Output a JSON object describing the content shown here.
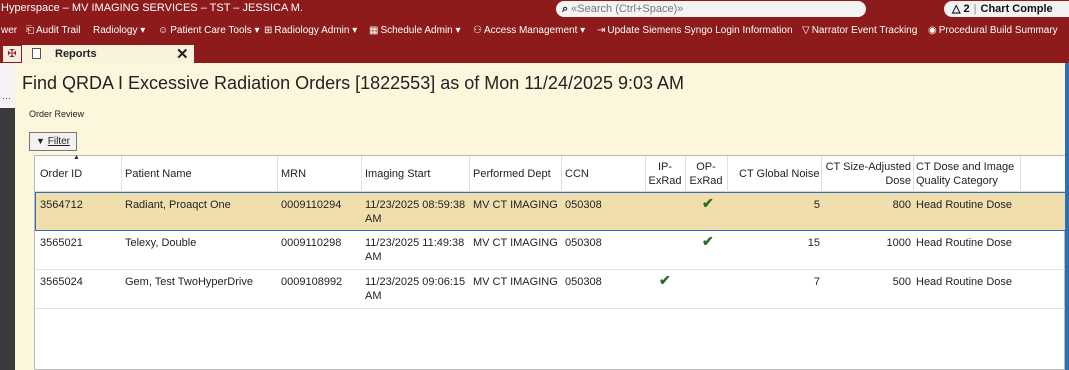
{
  "titlebar": {
    "app_title": "Hyperspace – MV IMAGING SERVICES – TST – JESSICA M.",
    "search_placeholder": "«Search (Ctrl+Space)»",
    "notify_count": "2",
    "chart_label": "Chart Comple"
  },
  "toolbar": {
    "items": [
      {
        "label": "wer"
      },
      {
        "label": "Audit Trail"
      },
      {
        "label": "Radiology ▾"
      },
      {
        "label": "Patient Care Tools ▾"
      },
      {
        "label": "Radiology Admin ▾"
      },
      {
        "label": "Schedule Admin ▾"
      },
      {
        "label": "Access Management ▾"
      },
      {
        "label": "Update Siemens Syngo Login Information"
      },
      {
        "label": "Narrator Event Tracking"
      },
      {
        "label": "Procedural Build Summary"
      }
    ]
  },
  "tabs": {
    "reports_label": "Reports"
  },
  "page": {
    "title": "Find QRDA I Excessive Radiation Orders [1822553] as of Mon 11/24/2025 9:03 AM",
    "subtitle": "Order Review",
    "filter_label": "Filter"
  },
  "table": {
    "columns": {
      "order_id": "Order ID",
      "patient_name": "Patient Name",
      "mrn": "MRN",
      "imaging_start": "Imaging Start",
      "performed_dept": "Performed Dept",
      "ccn": "CCN",
      "ip_exrad": "IP-ExRad",
      "op_exrad": "OP-ExRad",
      "ct_global_noise": "CT Global Noise",
      "ct_size_adjusted_dose": "CT Size-Adjusted Dose",
      "ct_dose_category": "CT Dose and Image Quality Category"
    },
    "rows": [
      {
        "order_id": "3564712",
        "patient_name": "Radiant, Proaqct One",
        "mrn": "0009110294",
        "imaging_start": "11/23/2025 08:59:38 AM",
        "performed_dept": "MV CT IMAGING",
        "ccn": "050308",
        "ip_exrad": false,
        "op_exrad": true,
        "ct_global_noise": "5",
        "ct_size_adjusted_dose": "800",
        "ct_dose_category": "Head Routine Dose",
        "selected": true
      },
      {
        "order_id": "3565021",
        "patient_name": "Telexy, Double",
        "mrn": "0009110298",
        "imaging_start": "11/23/2025 11:49:38 AM",
        "performed_dept": "MV CT IMAGING",
        "ccn": "050308",
        "ip_exrad": false,
        "op_exrad": true,
        "ct_global_noise": "15",
        "ct_size_adjusted_dose": "1000",
        "ct_dose_category": "Head Routine Dose",
        "selected": false
      },
      {
        "order_id": "3565024",
        "patient_name": "Gem, Test TwoHyperDrive",
        "mrn": "0009108992",
        "imaging_start": "11/23/2025 09:06:15 AM",
        "performed_dept": "MV CT IMAGING",
        "ccn": "050308",
        "ip_exrad": true,
        "op_exrad": false,
        "ct_global_noise": "7",
        "ct_size_adjusted_dose": "500",
        "ct_dose_category": "Head Routine Dose",
        "selected": false
      }
    ]
  }
}
